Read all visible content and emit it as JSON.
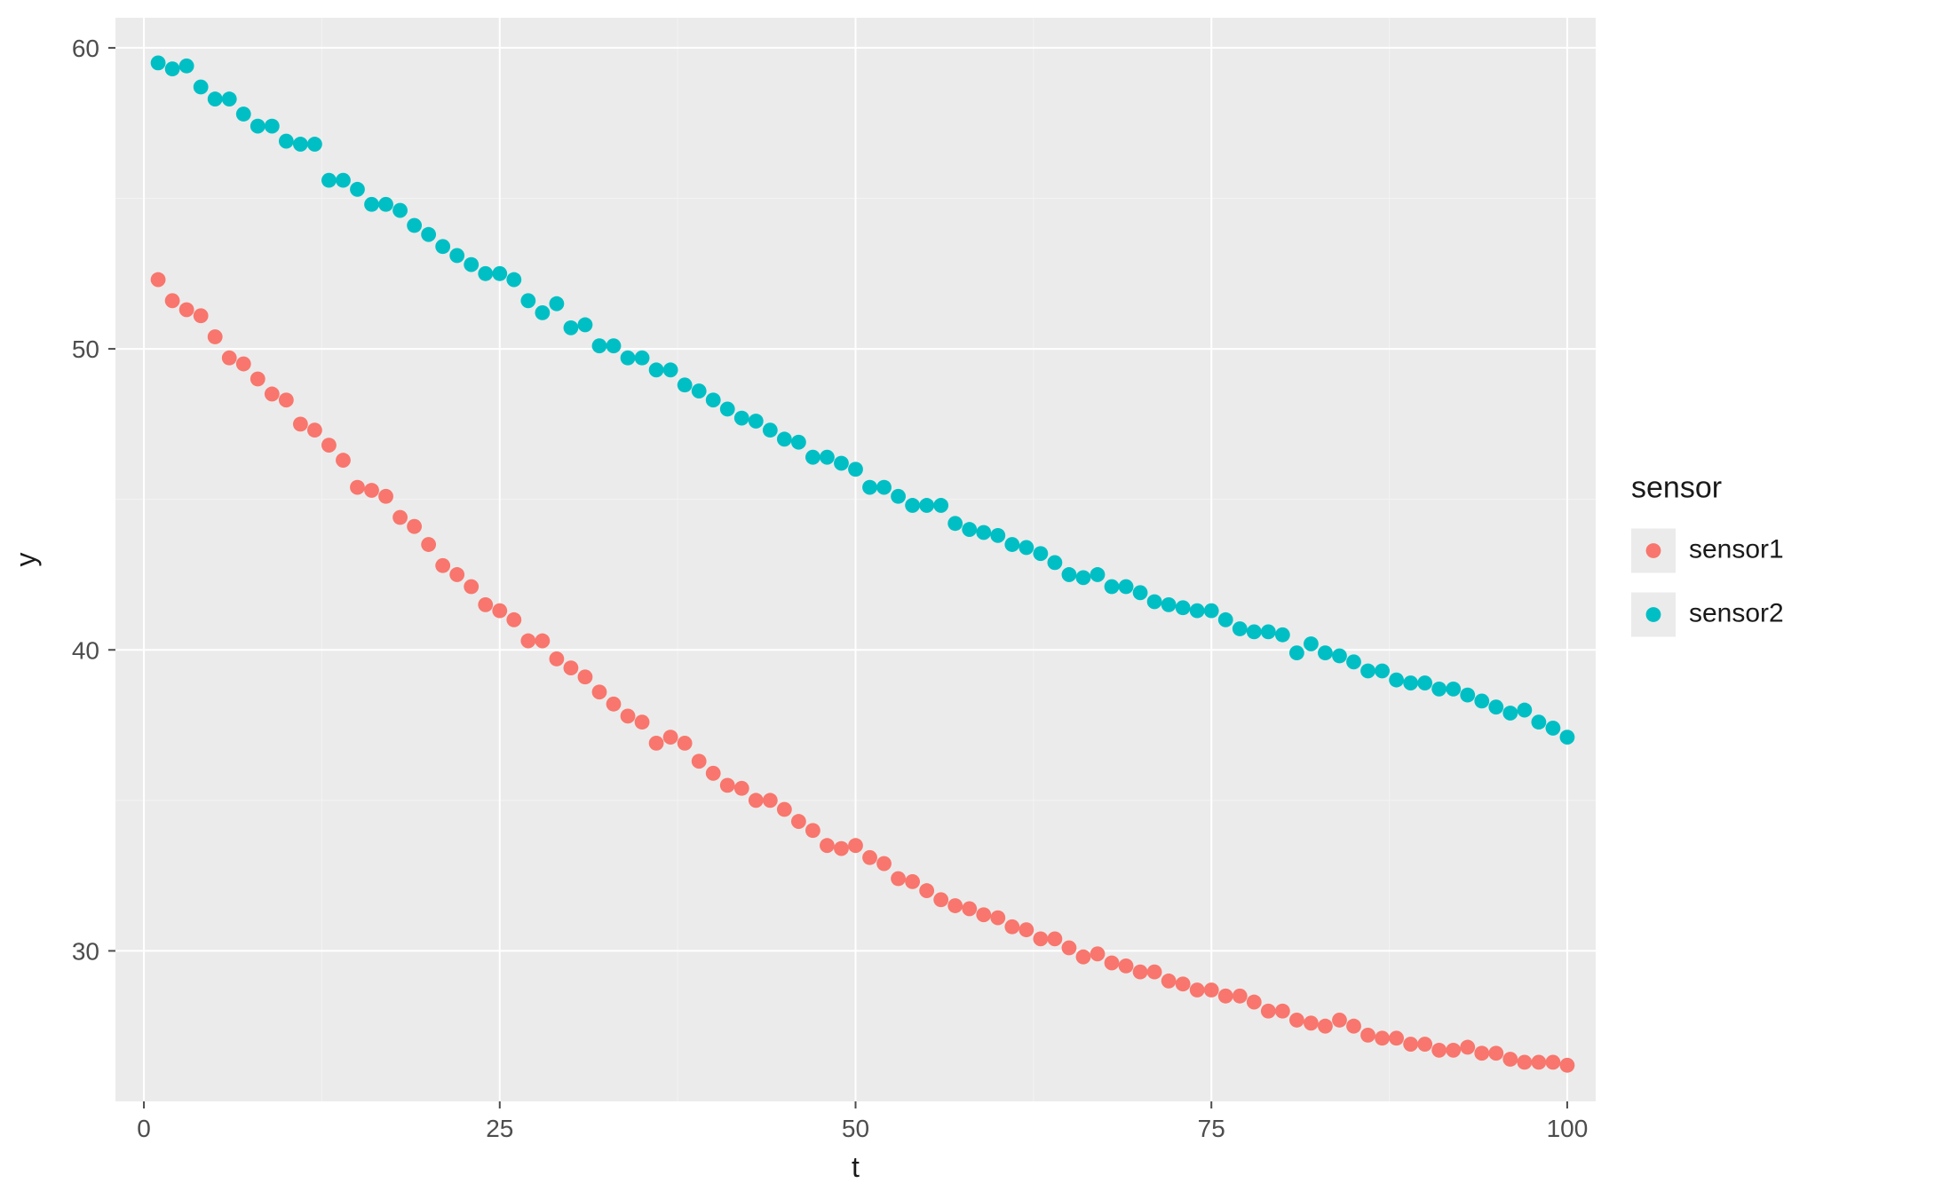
{
  "chart_data": {
    "type": "scatter",
    "xlabel": "t",
    "ylabel": "y",
    "x_ticks": [
      0,
      25,
      50,
      75,
      100
    ],
    "y_ticks": [
      30,
      40,
      50,
      60
    ],
    "xlim": [
      -2,
      102
    ],
    "ylim": [
      25,
      61
    ],
    "legend_title": "sensor",
    "legend_position": "right",
    "panel_bg": "#EBEBEB",
    "grid_major": "#FFFFFF",
    "grid_minor": "#F3F3F3",
    "tick_color": "#4d4d4d",
    "point_radius": 4.2,
    "series": [
      {
        "name": "sensor1",
        "color": "#F8766D",
        "x": [
          1,
          2,
          3,
          4,
          5,
          6,
          7,
          8,
          9,
          10,
          11,
          12,
          13,
          14,
          15,
          16,
          17,
          18,
          19,
          20,
          21,
          22,
          23,
          24,
          25,
          26,
          27,
          28,
          29,
          30,
          31,
          32,
          33,
          34,
          35,
          36,
          37,
          38,
          39,
          40,
          41,
          42,
          43,
          44,
          45,
          46,
          47,
          48,
          49,
          50,
          51,
          52,
          53,
          54,
          55,
          56,
          57,
          58,
          59,
          60,
          61,
          62,
          63,
          64,
          65,
          66,
          67,
          68,
          69,
          70,
          71,
          72,
          73,
          74,
          75,
          76,
          77,
          78,
          79,
          80,
          81,
          82,
          83,
          84,
          85,
          86,
          87,
          88,
          89,
          90,
          91,
          92,
          93,
          94,
          95,
          96,
          97,
          98,
          99,
          100
        ],
        "y": [
          52.3,
          51.6,
          51.3,
          51.1,
          50.4,
          49.7,
          49.5,
          49.0,
          48.5,
          48.3,
          47.5,
          47.3,
          46.8,
          46.3,
          45.4,
          45.3,
          45.1,
          44.4,
          44.1,
          43.5,
          42.8,
          42.5,
          42.1,
          41.5,
          41.3,
          41.0,
          40.3,
          40.3,
          39.7,
          39.4,
          39.1,
          38.6,
          38.2,
          37.8,
          37.6,
          36.9,
          37.1,
          36.9,
          36.3,
          35.9,
          35.5,
          35.4,
          35.0,
          35.0,
          34.7,
          34.3,
          34.0,
          33.5,
          33.4,
          33.5,
          33.1,
          32.9,
          32.4,
          32.3,
          32.0,
          31.7,
          31.5,
          31.4,
          31.2,
          31.1,
          30.8,
          30.7,
          30.4,
          30.4,
          30.1,
          29.8,
          29.9,
          29.6,
          29.5,
          29.3,
          29.3,
          29.0,
          28.9,
          28.7,
          28.7,
          28.5,
          28.5,
          28.3,
          28.0,
          28.0,
          27.7,
          27.6,
          27.5,
          27.7,
          27.5,
          27.2,
          27.1,
          27.1,
          26.9,
          26.9,
          26.7,
          26.7,
          26.8,
          26.6,
          26.6,
          26.4,
          26.3,
          26.3,
          26.3,
          26.2
        ]
      },
      {
        "name": "sensor2",
        "color": "#00BFC4",
        "x": [
          1,
          2,
          3,
          4,
          5,
          6,
          7,
          8,
          9,
          10,
          11,
          12,
          13,
          14,
          15,
          16,
          17,
          18,
          19,
          20,
          21,
          22,
          23,
          24,
          25,
          26,
          27,
          28,
          29,
          30,
          31,
          32,
          33,
          34,
          35,
          36,
          37,
          38,
          39,
          40,
          41,
          42,
          43,
          44,
          45,
          46,
          47,
          48,
          49,
          50,
          51,
          52,
          53,
          54,
          55,
          56,
          57,
          58,
          59,
          60,
          61,
          62,
          63,
          64,
          65,
          66,
          67,
          68,
          69,
          70,
          71,
          72,
          73,
          74,
          75,
          76,
          77,
          78,
          79,
          80,
          81,
          82,
          83,
          84,
          85,
          86,
          87,
          88,
          89,
          90,
          91,
          92,
          93,
          94,
          95,
          96,
          97,
          98,
          99,
          100
        ],
        "y": [
          59.5,
          59.3,
          59.4,
          58.7,
          58.3,
          58.3,
          57.8,
          57.4,
          57.4,
          56.9,
          56.8,
          56.8,
          55.6,
          55.6,
          55.3,
          54.8,
          54.8,
          54.6,
          54.1,
          53.8,
          53.4,
          53.1,
          52.8,
          52.5,
          52.5,
          52.3,
          51.6,
          51.2,
          51.5,
          50.7,
          50.8,
          50.1,
          50.1,
          49.7,
          49.7,
          49.3,
          49.3,
          48.8,
          48.6,
          48.3,
          48.0,
          47.7,
          47.6,
          47.3,
          47.0,
          46.9,
          46.4,
          46.4,
          46.2,
          46.0,
          45.4,
          45.4,
          45.1,
          44.8,
          44.8,
          44.8,
          44.2,
          44.0,
          43.9,
          43.8,
          43.5,
          43.4,
          43.2,
          42.9,
          42.5,
          42.4,
          42.5,
          42.1,
          42.1,
          41.9,
          41.6,
          41.5,
          41.4,
          41.3,
          41.3,
          41.0,
          40.7,
          40.6,
          40.6,
          40.5,
          39.9,
          40.2,
          39.9,
          39.8,
          39.6,
          39.3,
          39.3,
          39.0,
          38.9,
          38.9,
          38.7,
          38.7,
          38.5,
          38.3,
          38.1,
          37.9,
          38.0,
          37.6,
          37.4,
          37.1
        ]
      }
    ]
  }
}
